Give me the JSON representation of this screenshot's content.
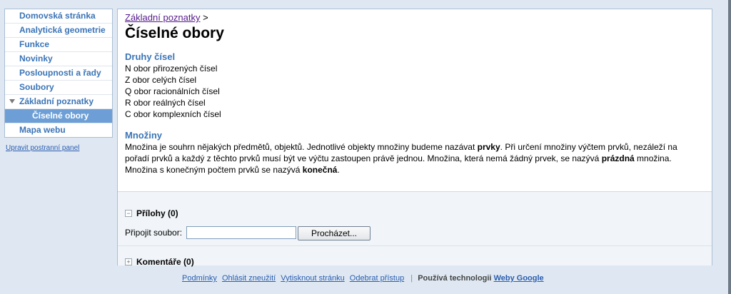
{
  "sidebar": {
    "items": [
      {
        "label": "Domovská stránka"
      },
      {
        "label": "Analytická geometrie"
      },
      {
        "label": "Funkce"
      },
      {
        "label": "Novinky"
      },
      {
        "label": "Posloupnosti a řady"
      },
      {
        "label": "Soubory"
      },
      {
        "label": "Základní poznatky"
      },
      {
        "label": "Číselné obory"
      },
      {
        "label": "Mapa webu"
      }
    ],
    "edit_link": "Upravit postranní panel"
  },
  "breadcrumb": {
    "parent": "Základní poznatky",
    "separator": ">"
  },
  "page_title": "Číselné obory",
  "sections": {
    "druhy": {
      "heading": "Druhy čísel",
      "lines": [
        "N obor přirozených čísel",
        "Z obor celých čísel",
        "Q obor racionálních čísel",
        "R obor reálných čísel",
        "C obor komplexních čísel"
      ]
    },
    "mnoziny": {
      "heading": "Množiny",
      "p1": "Množina je souhrn nějakých předmětů, objektů. Jednotlivé objekty množiny budeme nazávat ",
      "b1": "prvky",
      "p2": ". Při určení množiny výčtem prvků, nezáleží na pořadí prvků a každý z těchto prvků musí být ve výčtu zastoupen právě jednou. Množina, která nemá žádný prvek, se nazývá ",
      "b2": "prázdná",
      "p3": " množina. Množina s konečným počtem prvků se nazývá ",
      "b3": "konečná",
      "p4": "."
    }
  },
  "attachments": {
    "toggle": "−",
    "title": "Přílohy (0)",
    "attach_label": "Připojit soubor:",
    "input_value": "",
    "browse_label": "Procházet..."
  },
  "comments": {
    "toggle": "+",
    "title": "Komentáře (0)"
  },
  "footer": {
    "links": [
      "Podmínky",
      "Ohlásit zneužití",
      "Vytisknout stránku",
      "Odebrat přístup"
    ],
    "separator": "|",
    "tech_text": "Používá technologii",
    "brand": "Weby Google"
  }
}
